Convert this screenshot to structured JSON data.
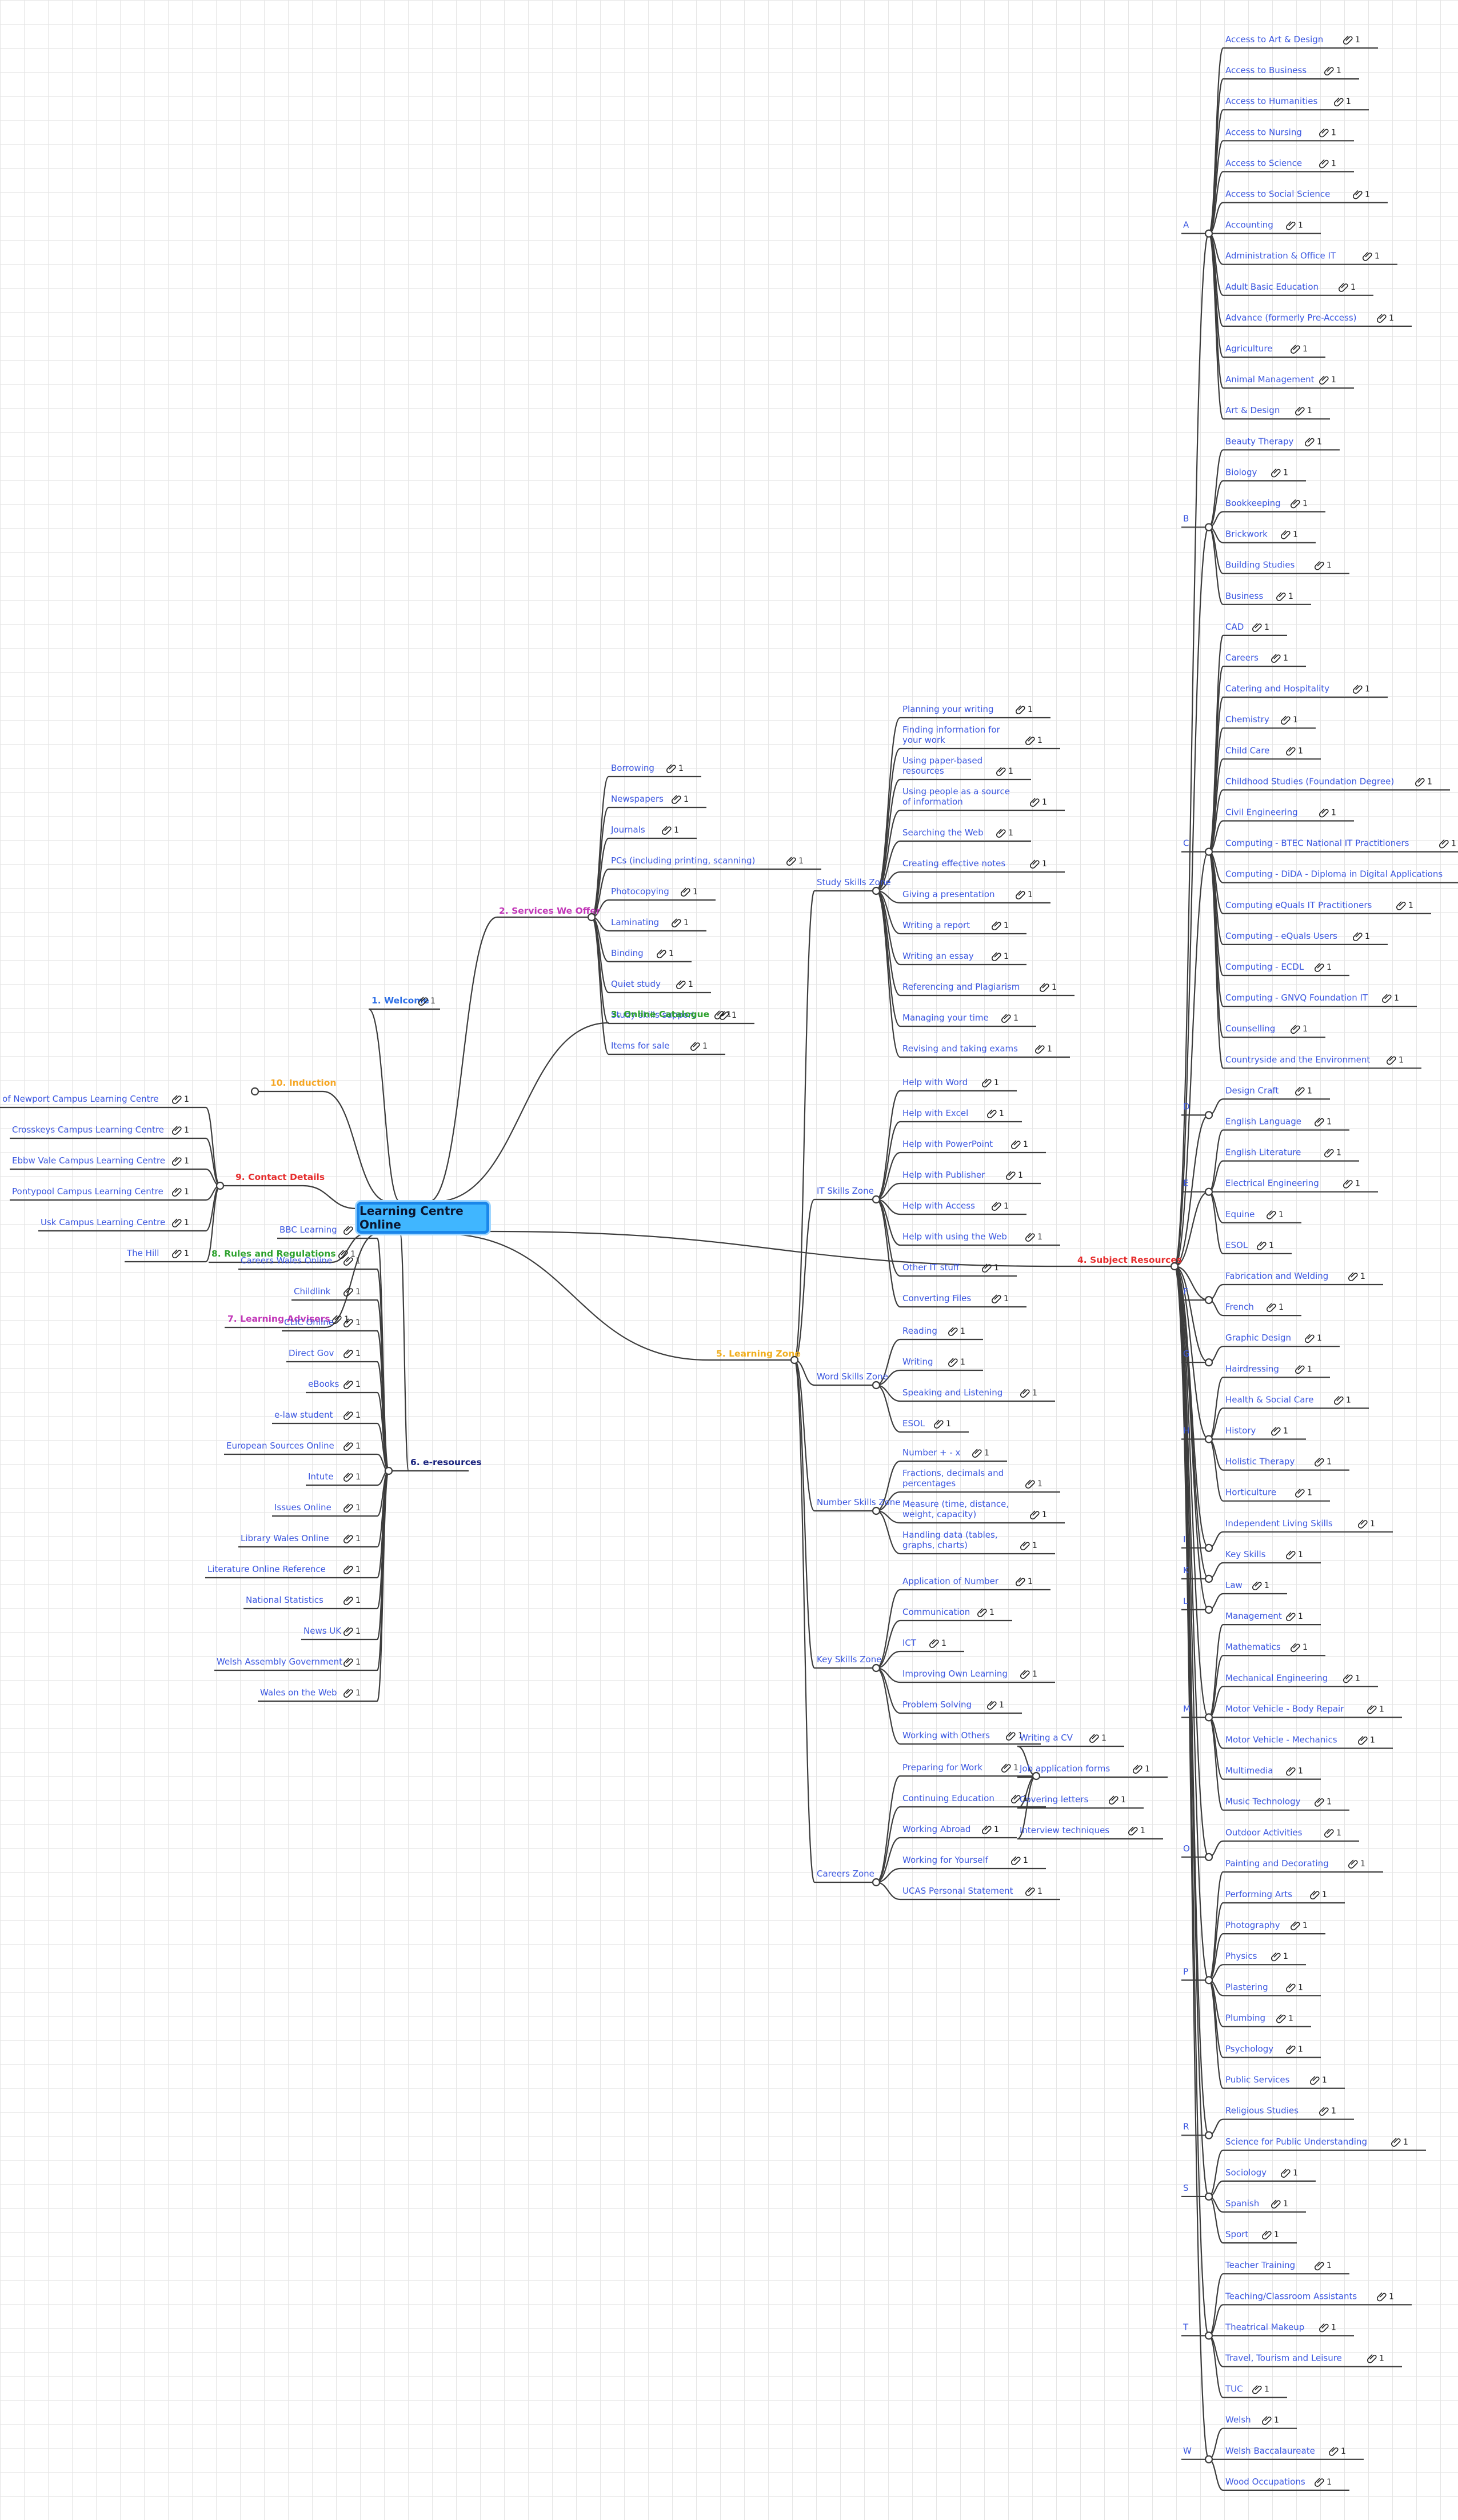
{
  "central_topic": "Learning Centre Online",
  "topics": [
    {
      "id": "welcome",
      "label": "1. Welcome",
      "color": "#2d6fe6",
      "count": "1"
    },
    {
      "id": "services",
      "label": "2. Services We Offer",
      "color": "#c237b8",
      "items": [
        {
          "label": "Borrowing",
          "count": "1"
        },
        {
          "label": "Newspapers",
          "count": "1"
        },
        {
          "label": "Journals",
          "count": "1"
        },
        {
          "label": "PCs (including printing, scanning)",
          "count": "1"
        },
        {
          "label": "Photocopying",
          "count": "1"
        },
        {
          "label": "Laminating",
          "count": "1"
        },
        {
          "label": "Binding",
          "count": "1"
        },
        {
          "label": "Quiet study",
          "count": "1"
        },
        {
          "label": "Study skills support",
          "count": "1"
        },
        {
          "label": "Items for sale",
          "count": "1"
        }
      ]
    },
    {
      "id": "online-catalogue",
      "label": "3. Online Catalogue",
      "color": "#2ea12e",
      "count": "1"
    },
    {
      "id": "subject",
      "label": "4. Subject Resources",
      "color": "#e62e2e",
      "groups": [
        {
          "letter": "A",
          "items": [
            {
              "label": "Access to Art & Design",
              "count": "1"
            },
            {
              "label": "Access to Business",
              "count": "1"
            },
            {
              "label": "Access to Humanities",
              "count": "1"
            },
            {
              "label": "Access to Nursing",
              "count": "1"
            },
            {
              "label": "Access to Science",
              "count": "1"
            },
            {
              "label": "Access to Social Science",
              "count": "1"
            },
            {
              "label": "Accounting",
              "count": "1"
            },
            {
              "label": "Administration & Office IT",
              "count": "1"
            },
            {
              "label": "Adult Basic Education",
              "count": "1"
            },
            {
              "label": "Advance (formerly Pre-Access)",
              "count": "1"
            },
            {
              "label": "Agriculture",
              "count": "1"
            },
            {
              "label": "Animal Management",
              "count": "1"
            },
            {
              "label": "Art & Design",
              "count": "1"
            }
          ]
        },
        {
          "letter": "B",
          "items": [
            {
              "label": "Beauty Therapy",
              "count": "1"
            },
            {
              "label": "Biology",
              "count": "1"
            },
            {
              "label": "Bookkeeping",
              "count": "1"
            },
            {
              "label": "Brickwork",
              "count": "1"
            },
            {
              "label": "Building Studies",
              "count": "1"
            },
            {
              "label": "Business",
              "count": "1"
            }
          ]
        },
        {
          "letter": "C",
          "items": [
            {
              "label": "CAD",
              "count": "1"
            },
            {
              "label": "Careers",
              "count": "1"
            },
            {
              "label": "Catering and Hospitality",
              "count": "1"
            },
            {
              "label": "Chemistry",
              "count": "1"
            },
            {
              "label": "Child Care",
              "count": "1"
            },
            {
              "label": "Childhood Studies (Foundation Degree)",
              "count": "1"
            },
            {
              "label": "Civil Engineering",
              "count": "1"
            },
            {
              "label": "Computing - BTEC National IT Practitioners",
              "count": "1"
            },
            {
              "label": "Computing - DiDA - Diploma in Digital Applications",
              "count": "1"
            },
            {
              "label": "Computing eQuals IT Practitioners",
              "count": "1"
            },
            {
              "label": "Computing - eQuals Users",
              "count": "1"
            },
            {
              "label": "Computing - ECDL",
              "count": "1"
            },
            {
              "label": "Computing - GNVQ Foundation IT",
              "count": "1"
            },
            {
              "label": "Counselling",
              "count": "1"
            },
            {
              "label": "Countryside and the Environment",
              "count": "1"
            }
          ]
        },
        {
          "letter": "D",
          "items": [
            {
              "label": "Design Craft",
              "count": "1"
            }
          ]
        },
        {
          "letter": "E",
          "items": [
            {
              "label": "English Language",
              "count": "1"
            },
            {
              "label": "English Literature",
              "count": "1"
            },
            {
              "label": "Electrical Engineering",
              "count": "1"
            },
            {
              "label": "Equine",
              "count": "1"
            },
            {
              "label": "ESOL",
              "count": "1"
            }
          ]
        },
        {
          "letter": "F",
          "items": [
            {
              "label": "Fabrication and Welding",
              "count": "1"
            },
            {
              "label": "French",
              "count": "1"
            }
          ]
        },
        {
          "letter": "G",
          "items": [
            {
              "label": "Graphic Design",
              "count": "1"
            }
          ]
        },
        {
          "letter": "H",
          "items": [
            {
              "label": "Hairdressing",
              "count": "1"
            },
            {
              "label": "Health & Social Care",
              "count": "1"
            },
            {
              "label": "History",
              "count": "1"
            },
            {
              "label": "Holistic Therapy",
              "count": "1"
            },
            {
              "label": "Horticulture",
              "count": "1"
            }
          ]
        },
        {
          "letter": "I",
          "items": [
            {
              "label": "Independent Living Skills",
              "count": "1"
            }
          ]
        },
        {
          "letter": "K",
          "items": [
            {
              "label": "Key Skills",
              "count": "1"
            }
          ]
        },
        {
          "letter": "L",
          "items": [
            {
              "label": "Law",
              "count": "1"
            }
          ]
        },
        {
          "letter": "M",
          "items": [
            {
              "label": "Management",
              "count": "1"
            },
            {
              "label": "Mathematics",
              "count": "1"
            },
            {
              "label": "Mechanical Engineering",
              "count": "1"
            },
            {
              "label": "Motor Vehicle - Body Repair",
              "count": "1"
            },
            {
              "label": "Motor Vehicle - Mechanics",
              "count": "1"
            },
            {
              "label": "Multimedia",
              "count": "1"
            },
            {
              "label": "Music Technology",
              "count": "1"
            }
          ]
        },
        {
          "letter": "O",
          "items": [
            {
              "label": "Outdoor Activities",
              "count": "1"
            }
          ]
        },
        {
          "letter": "P",
          "items": [
            {
              "label": "Painting and Decorating",
              "count": "1"
            },
            {
              "label": "Performing Arts",
              "count": "1"
            },
            {
              "label": "Photography",
              "count": "1"
            },
            {
              "label": "Physics",
              "count": "1"
            },
            {
              "label": "Plastering",
              "count": "1"
            },
            {
              "label": "Plumbing",
              "count": "1"
            },
            {
              "label": "Psychology",
              "count": "1"
            },
            {
              "label": "Public Services",
              "count": "1"
            }
          ]
        },
        {
          "letter": "R",
          "items": [
            {
              "label": "Religious Studies",
              "count": "1"
            }
          ]
        },
        {
          "letter": "S",
          "items": [
            {
              "label": "Science for Public Understanding",
              "count": "1"
            },
            {
              "label": "Sociology",
              "count": "1"
            },
            {
              "label": "Spanish",
              "count": "1"
            },
            {
              "label": "Sport",
              "count": "1"
            }
          ]
        },
        {
          "letter": "T",
          "items": [
            {
              "label": "Teacher Training",
              "count": "1"
            },
            {
              "label": "Teaching/Classroom Assistants",
              "count": "1"
            },
            {
              "label": "Theatrical Makeup",
              "count": "1"
            },
            {
              "label": "Travel, Tourism and Leisure",
              "count": "1"
            },
            {
              "label": "TUC",
              "count": "1"
            }
          ]
        },
        {
          "letter": "W",
          "items": [
            {
              "label": "Welsh",
              "count": "1"
            },
            {
              "label": "Welsh Baccalaureate",
              "count": "1"
            },
            {
              "label": "Wood Occupations",
              "count": "1"
            }
          ]
        }
      ]
    },
    {
      "id": "learning-zone",
      "label": "5. Learning Zone",
      "color": "#f0ad1c",
      "zones": [
        {
          "name": "Study Skills Zone",
          "items": [
            {
              "label": "Planning your writing",
              "count": "1"
            },
            {
              "label": "Finding information for your work",
              "count": "1"
            },
            {
              "label": "Using paper-based resources",
              "count": "1"
            },
            {
              "label": "Using people as a source of information",
              "count": "1"
            },
            {
              "label": "Searching the Web",
              "count": "1"
            },
            {
              "label": "Creating effective notes",
              "count": "1"
            },
            {
              "label": "Giving a presentation",
              "count": "1"
            },
            {
              "label": "Writing a report",
              "count": "1"
            },
            {
              "label": "Writing an essay",
              "count": "1"
            },
            {
              "label": "Referencing and Plagiarism",
              "count": "1"
            },
            {
              "label": "Managing your time",
              "count": "1"
            },
            {
              "label": "Revising and taking exams",
              "count": "1"
            }
          ]
        },
        {
          "name": "IT Skills Zone",
          "items": [
            {
              "label": "Help with Word",
              "count": "1"
            },
            {
              "label": "Help with Excel",
              "count": "1"
            },
            {
              "label": "Help with PowerPoint",
              "count": "1"
            },
            {
              "label": "Help with Publisher",
              "count": "1"
            },
            {
              "label": "Help with Access",
              "count": "1"
            },
            {
              "label": "Help with using the Web",
              "count": "1"
            },
            {
              "label": "Other IT stuff",
              "count": "1"
            },
            {
              "label": "Converting Files",
              "count": "1"
            }
          ]
        },
        {
          "name": "Word Skills Zone",
          "items": [
            {
              "label": "Reading",
              "count": "1"
            },
            {
              "label": "Writing",
              "count": "1"
            },
            {
              "label": "Speaking and Listening",
              "count": "1"
            },
            {
              "label": "ESOL",
              "count": "1"
            }
          ]
        },
        {
          "name": "Number Skills Zone",
          "items": [
            {
              "label": "Number + - x",
              "count": "1"
            },
            {
              "label": "Fractions, decimals and percentages",
              "count": "1"
            },
            {
              "label": "Measure (time, distance, weight, capacity)",
              "count": "1"
            },
            {
              "label": "Handling data (tables, graphs, charts)",
              "count": "1"
            }
          ]
        },
        {
          "name": "Key Skills Zone",
          "items": [
            {
              "label": "Application of Number",
              "count": "1"
            },
            {
              "label": "Communication",
              "count": "1"
            },
            {
              "label": "ICT",
              "count": "1"
            },
            {
              "label": "Improving Own Learning",
              "count": "1"
            },
            {
              "label": "Problem Solving",
              "count": "1"
            },
            {
              "label": "Working with Others",
              "count": "1"
            }
          ]
        },
        {
          "name": "Careers Zone",
          "items": [
            {
              "label": "Preparing for Work",
              "count": "1",
              "children": [
                {
                  "label": "Writing a CV",
                  "count": "1"
                },
                {
                  "label": "Job application forms",
                  "count": "1"
                },
                {
                  "label": "Covering letters",
                  "count": "1"
                },
                {
                  "label": "Interview techniques",
                  "count": "1"
                }
              ]
            },
            {
              "label": "Continuing Education",
              "count": "1"
            },
            {
              "label": "Working Abroad",
              "count": "1"
            },
            {
              "label": "Working for Yourself",
              "count": "1"
            },
            {
              "label": "UCAS Personal Statement",
              "count": "1"
            }
          ]
        }
      ]
    },
    {
      "id": "e-resources",
      "label": "6. e-resources",
      "color": "#1a237e",
      "items": [
        {
          "label": "BBC Learning",
          "count": "1"
        },
        {
          "label": "Careers Wales Online",
          "count": "1"
        },
        {
          "label": "Childlink",
          "count": "1"
        },
        {
          "label": "CLIC Online",
          "count": "1"
        },
        {
          "label": "Direct Gov",
          "count": "1"
        },
        {
          "label": "eBooks",
          "count": "1"
        },
        {
          "label": "e-law student",
          "count": "1"
        },
        {
          "label": "European Sources Online",
          "count": "1"
        },
        {
          "label": "Intute",
          "count": "1"
        },
        {
          "label": "Issues Online",
          "count": "1"
        },
        {
          "label": "Library Wales Online",
          "count": "1"
        },
        {
          "label": "Literature Online Reference",
          "count": "1"
        },
        {
          "label": "National Statistics",
          "count": "1"
        },
        {
          "label": "News UK",
          "count": "1"
        },
        {
          "label": "Welsh Assembly Government",
          "count": "1"
        },
        {
          "label": "Wales on the Web",
          "count": "1"
        }
      ]
    },
    {
      "id": "advisers",
      "label": "7. Learning Advisers",
      "color": "#c237b8",
      "count": "1"
    },
    {
      "id": "rules",
      "label": "8. Rules and Regulations",
      "color": "#2ea12e",
      "count": "1"
    },
    {
      "id": "contact",
      "label": "9. Contact Details",
      "color": "#e62e2e",
      "items": [
        {
          "label": "City of Newport Campus Learning Centre",
          "count": "1"
        },
        {
          "label": "Crosskeys Campus Learning Centre",
          "count": "1"
        },
        {
          "label": "Ebbw Vale Campus Learning Centre",
          "count": "1"
        },
        {
          "label": "Pontypool Campus Learning Centre",
          "count": "1"
        },
        {
          "label": "Usk Campus Learning Centre",
          "count": "1"
        },
        {
          "label": "The Hill",
          "count": "1"
        }
      ]
    },
    {
      "id": "induction",
      "label": "10. Induction",
      "color": "#f5a623"
    }
  ]
}
